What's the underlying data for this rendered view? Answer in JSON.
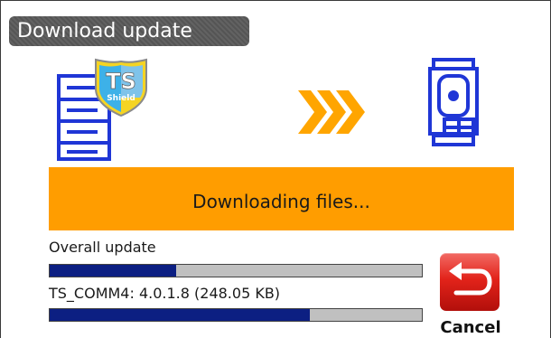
{
  "window": {
    "title": "Download update"
  },
  "transfer": {
    "source_icon": "server-with-ts-shield-icon",
    "source_badge": "TS Shield",
    "direction_icon": "triple-chevron-right-icon",
    "target_icon": "total-station-instrument-icon"
  },
  "status": {
    "message": "Downloading files..."
  },
  "progress": {
    "overall": {
      "label": "Overall update",
      "fraction": 0.34
    },
    "file": {
      "label": "TS_COMM4: 4.0.1.8 (248.05 KB)",
      "fraction": 0.7
    }
  },
  "actions": {
    "cancel_label": "Cancel",
    "cancel_icon": "return-arrow-icon"
  },
  "colors": {
    "title_bar": "#555555",
    "status_bar": "#ff9d00",
    "progress_fill": "#0c1f82",
    "progress_track": "#c0c0c0",
    "icon_blue": "#1f36d6",
    "arrow_orange": "#ffa500",
    "cancel_red": "#e2231a"
  }
}
